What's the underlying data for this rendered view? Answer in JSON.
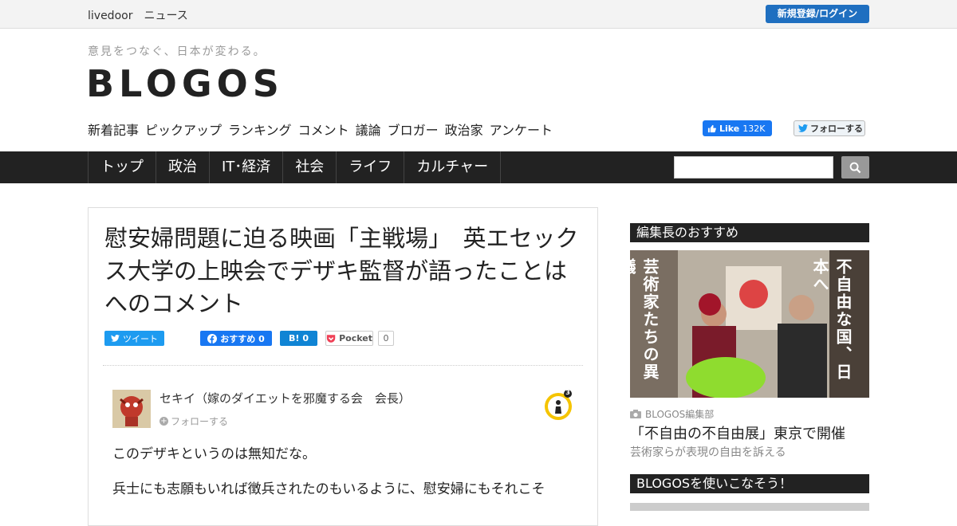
{
  "topbar": {
    "site": "livedoor　ニュース",
    "login": "新規登録/ログイン"
  },
  "header": {
    "tagline": "意見をつなぐ、日本が変わる。",
    "logo": "BLOGOS"
  },
  "subnav": [
    "新着記事",
    "ピックアップ",
    "ランキング",
    "コメント",
    "議論",
    "ブロガー",
    "政治家",
    "アンケート"
  ],
  "social": {
    "fb_like": "Like",
    "fb_count": "132K",
    "tw_follow": "フォローする"
  },
  "mainnav": [
    "トップ",
    "政治",
    "IT･経済",
    "社会",
    "ライフ",
    "カルチャー"
  ],
  "article": {
    "title": "慰安婦問題に迫る映画「主戦場」　英エセックス大学の上映会でデザキ監督が語ったことはへのコメント",
    "share": {
      "tweet": "ツイート",
      "fb": "おすすめ 0",
      "hb_count": "0",
      "pocket": "Pocket",
      "pocket_count": "0"
    },
    "author": "セキイ（嫁のダイエットを邪魔する会　会長）",
    "follow": "フォローする",
    "badge_count": "3",
    "paragraphs": [
      "このデザキというのは無知だな。",
      "兵士にも志願もいれば徴兵されたのもいるように、慰安婦にもそれこそ"
    ]
  },
  "sidebar": {
    "heading1": "編集長のおすすめ",
    "feature": {
      "left_text": "芸術家たちの異議",
      "right_text": "不自由な国、日本へ",
      "source": "BLOGOS編集部",
      "title": "「不自由の不自由展」東京で開催",
      "subtitle": "芸術家らが表現の自由を訴える"
    },
    "heading2": "BLOGOSを使いこなそう！"
  },
  "colors": {
    "accent": "#1f6fc0",
    "nav_bg": "#222222"
  }
}
